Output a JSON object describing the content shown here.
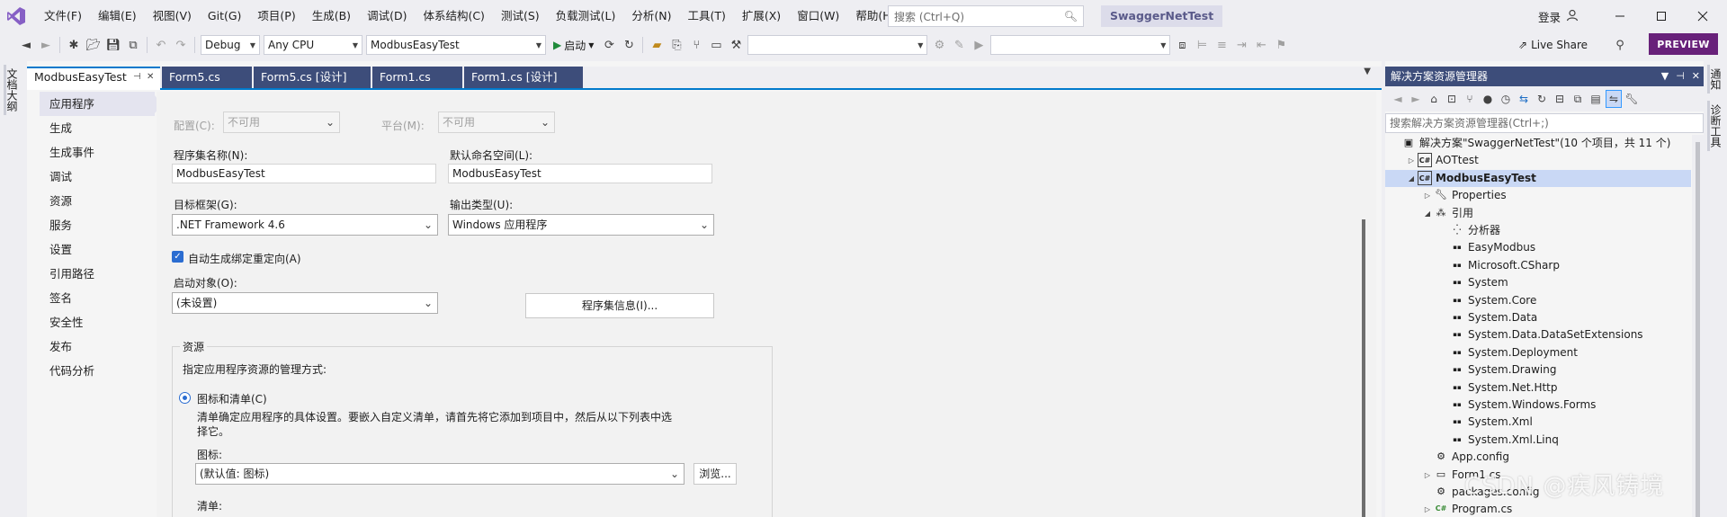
{
  "titlebar": {
    "menu": [
      "文件(F)",
      "编辑(E)",
      "视图(V)",
      "Git(G)",
      "项目(P)",
      "生成(B)",
      "调试(D)",
      "体系结构(C)",
      "测试(S)",
      "负载测试(L)",
      "分析(N)",
      "工具(T)",
      "扩展(X)",
      "窗口(W)",
      "帮助(H)"
    ],
    "search_placeholder": "搜索 (Ctrl+Q)",
    "solution_name": "SwaggerNetTest",
    "login_label": "登录"
  },
  "toolbar": {
    "config": "Debug",
    "platform": "Any CPU",
    "startup_project": "ModbusEasyTest",
    "start_label": "启动",
    "liveshare_label": "Live Share",
    "preview_label": "PREVIEW"
  },
  "left_strip": {
    "label": "文档大纲"
  },
  "right_strip": {
    "labels": [
      "通知",
      "诊断工具"
    ]
  },
  "doc_tabs": {
    "items": [
      {
        "label": "ModbusEasyTest",
        "active": true,
        "pin": "⊣",
        "close": "✕"
      },
      {
        "label": "Form5.cs"
      },
      {
        "label": "Form5.cs [设计]"
      },
      {
        "label": "Form1.cs"
      },
      {
        "label": "Form1.cs [设计]"
      }
    ]
  },
  "nav": {
    "items": [
      "应用程序",
      "生成",
      "生成事件",
      "调试",
      "资源",
      "服务",
      "设置",
      "引用路径",
      "签名",
      "安全性",
      "发布",
      "代码分析"
    ],
    "active_index": 0
  },
  "app_page": {
    "config_label": "配置(C):",
    "config_value": "不可用",
    "platform_label": "平台(M):",
    "platform_value": "不可用",
    "assembly_name_label": "程序集名称(N):",
    "assembly_name_value": "ModbusEasyTest",
    "default_namespace_label": "默认命名空间(L):",
    "default_namespace_value": "ModbusEasyTest",
    "target_framework_label": "目标框架(G):",
    "target_framework_value": ".NET Framework 4.6",
    "output_type_label": "输出类型(U):",
    "output_type_value": "Windows 应用程序",
    "auto_binding_label": "自动生成绑定重定向(A)",
    "auto_binding_checked": true,
    "startup_object_label": "启动对象(O):",
    "startup_object_value": "(未设置)",
    "assembly_info_button": "程序集信息(I)...",
    "resources_group_title": "资源",
    "resources_desc": "指定应用程序资源的管理方式:",
    "icon_manifest_label": "图标和清单(C)",
    "icon_manifest_desc_line1": "清单确定应用程序的具体设置。要嵌入自定义清单，请首先将它添加到项目中，然后从以下列表中选",
    "icon_manifest_desc_line2": "择它。",
    "icon_label": "图标:",
    "icon_value": "(默认值: 图标)",
    "browse_button": "浏览...",
    "manifest_label": "清单:"
  },
  "solution_explorer": {
    "title": "解决方案资源管理器",
    "search_placeholder": "搜索解决方案资源管理器(Ctrl+;)",
    "tree": [
      {
        "label": "解决方案\"SwaggerNetTest\"(10 个项目，共 11 个)",
        "level": 0,
        "icon": "solution-icon",
        "expander": ""
      },
      {
        "label": "AOTtest",
        "level": 1,
        "icon": "csharp-project-icon",
        "expander": "collapsed"
      },
      {
        "label": "ModbusEasyTest",
        "level": 1,
        "icon": "csharp-project-icon",
        "expander": "expanded",
        "selected": true,
        "bold": true
      },
      {
        "label": "Properties",
        "level": 2,
        "icon": "wrench-icon",
        "expander": "collapsed"
      },
      {
        "label": "引用",
        "level": 2,
        "icon": "references-icon",
        "expander": "expanded"
      },
      {
        "label": "分析器",
        "level": 3,
        "icon": "analyzer-icon",
        "expander": ""
      },
      {
        "label": "EasyModbus",
        "level": 3,
        "icon": "reference-icon",
        "expander": ""
      },
      {
        "label": "Microsoft.CSharp",
        "level": 3,
        "icon": "reference-icon",
        "expander": ""
      },
      {
        "label": "System",
        "level": 3,
        "icon": "reference-icon",
        "expander": ""
      },
      {
        "label": "System.Core",
        "level": 3,
        "icon": "reference-icon",
        "expander": ""
      },
      {
        "label": "System.Data",
        "level": 3,
        "icon": "reference-icon",
        "expander": ""
      },
      {
        "label": "System.Data.DataSetExtensions",
        "level": 3,
        "icon": "reference-icon",
        "expander": ""
      },
      {
        "label": "System.Deployment",
        "level": 3,
        "icon": "reference-icon",
        "expander": ""
      },
      {
        "label": "System.Drawing",
        "level": 3,
        "icon": "reference-icon",
        "expander": ""
      },
      {
        "label": "System.Net.Http",
        "level": 3,
        "icon": "reference-icon",
        "expander": ""
      },
      {
        "label": "System.Windows.Forms",
        "level": 3,
        "icon": "reference-icon",
        "expander": ""
      },
      {
        "label": "System.Xml",
        "level": 3,
        "icon": "reference-icon",
        "expander": ""
      },
      {
        "label": "System.Xml.Linq",
        "level": 3,
        "icon": "reference-icon",
        "expander": ""
      },
      {
        "label": "App.config",
        "level": 2,
        "icon": "config-file-icon",
        "expander": ""
      },
      {
        "label": "Form1.cs",
        "level": 2,
        "icon": "form-icon",
        "expander": "collapsed"
      },
      {
        "label": "packages.config",
        "level": 2,
        "icon": "config-file-icon",
        "expander": ""
      },
      {
        "label": "Program.cs",
        "level": 2,
        "icon": "csharp-file-icon",
        "expander": "collapsed"
      }
    ]
  },
  "watermark": "CSDN @疾风铸境",
  "colors": {
    "accent": "#007acc",
    "tab_inactive": "#3d4d7a",
    "preview": "#68217a",
    "selection": "#c9d8f5",
    "vs_logo": "#865fc5"
  }
}
